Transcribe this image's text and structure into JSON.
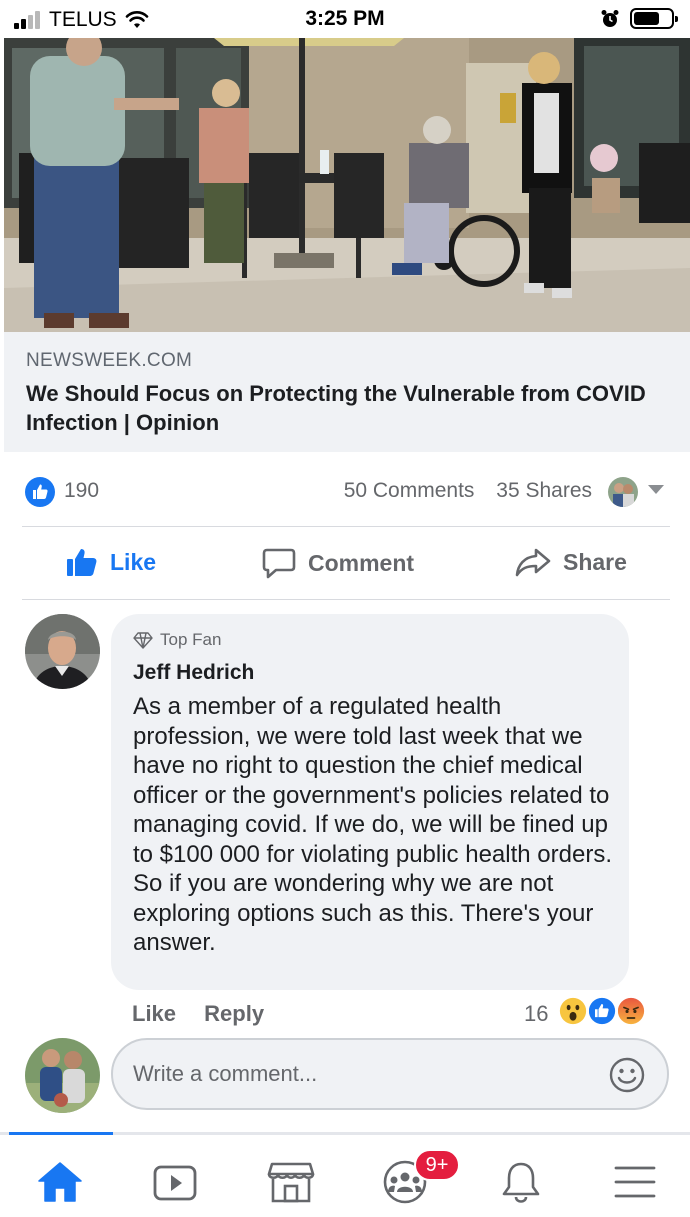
{
  "status_bar": {
    "carrier": "TELUS",
    "time": "3:25 PM"
  },
  "link_preview": {
    "domain": "NEWSWEEK.COM",
    "title": "We Should Focus on Protecting the Vulnerable from COVID Infection | Opinion"
  },
  "reactions": {
    "like_count": "190",
    "comments": "50 Comments",
    "shares": "35 Shares"
  },
  "actions": {
    "like": "Like",
    "comment": "Comment",
    "share": "Share"
  },
  "comment": {
    "badge": "Top Fan",
    "author": "Jeff Hedrich",
    "text": "As a member of a regulated health profession, we were told last week that we have no right to question the chief medical officer or the government's policies related to managing covid. If we do, we will be fined up to $100 000 for violating public health orders. So if you are wondering why we are not exploring options such as this. There's your answer.",
    "like_label": "Like",
    "reply_label": "Reply",
    "reaction_count": "16"
  },
  "composer": {
    "placeholder": "Write a comment..."
  },
  "bottom_nav": {
    "groups_badge": "9+"
  },
  "colors": {
    "facebook_blue": "#1877f2",
    "notification_red": "#e41e3f",
    "bubble_gray": "#f0f2f5"
  }
}
